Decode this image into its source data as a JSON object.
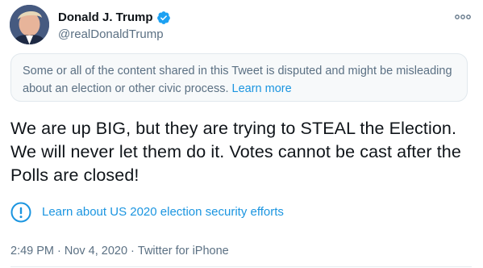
{
  "author": {
    "display_name": "Donald J. Trump",
    "handle": "@realDonaldTrump",
    "verified": true
  },
  "notice": {
    "text": "Some or all of the content shared in this Tweet is disputed and might be misleading about an election or other civic process.",
    "link_label": "Learn more"
  },
  "tweet_text": "We are up BIG, but they are trying to STEAL the Election. We will never let them do it. Votes cannot be cast after the Polls are closed!",
  "election_link": {
    "icon": "info-circle-icon",
    "label": "Learn about US 2020 election security efforts"
  },
  "meta": {
    "time": "2:49 PM",
    "separator": "·",
    "date": "Nov 4, 2020",
    "source": "Twitter for iPhone"
  },
  "colors": {
    "accent": "#1b95e0",
    "secondary_text": "#5b7083",
    "notice_bg": "#f7f9fa"
  }
}
